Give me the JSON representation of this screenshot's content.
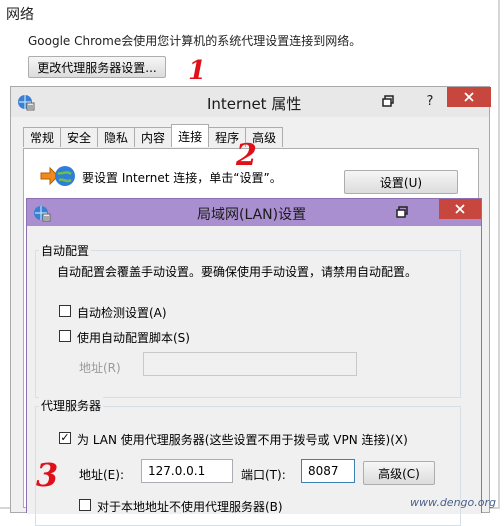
{
  "network_section": {
    "title": "网络",
    "description": "Google Chrome会使用您计算机的系统代理设置连接到网络。",
    "change_proxy_button": "更改代理服务器设置..."
  },
  "annotations": {
    "step1": "1",
    "step2": "2",
    "step3": "3"
  },
  "internet_properties": {
    "title": "Internet 属性",
    "help_label": "?",
    "tabs": [
      "常规",
      "安全",
      "隐私",
      "内容",
      "连接",
      "程序",
      "高级"
    ],
    "active_tab": "连接",
    "setup_text": "要设置 Internet 连接，单击“设置”。",
    "setup_button": "设置(U)"
  },
  "lan_settings": {
    "title": "局域网(LAN)设置",
    "auto_config": {
      "group_label": "自动配置",
      "description": "自动配置会覆盖手动设置。要确保使用手动设置，请禁用自动配置。",
      "auto_detect_label": "自动检测设置(A)",
      "auto_detect_checked": false,
      "use_script_label": "使用自动配置脚本(S)",
      "use_script_checked": false,
      "address_label": "地址(R)",
      "address_value": ""
    },
    "proxy": {
      "group_label": "代理服务器",
      "use_proxy_label": "为 LAN 使用代理服务器(这些设置不用于拨号或 VPN 连接)(X)",
      "use_proxy_checked": true,
      "address_label": "地址(E):",
      "address_value": "127.0.0.1",
      "port_label": "端口(T):",
      "port_value": "8087",
      "advanced_button": "高级(C)",
      "bypass_label": "对于本地地址不使用代理服务器(B)"
    }
  },
  "watermark": "www.dengo.org",
  "colors": {
    "lan_title_bar": "#a98fcf",
    "close_button": "#c7463d",
    "annotation": "#e0101b"
  },
  "icons": [
    "internet-options-icon",
    "globe-arrow-icon",
    "restore-icon",
    "close-icon",
    "check-icon"
  ]
}
